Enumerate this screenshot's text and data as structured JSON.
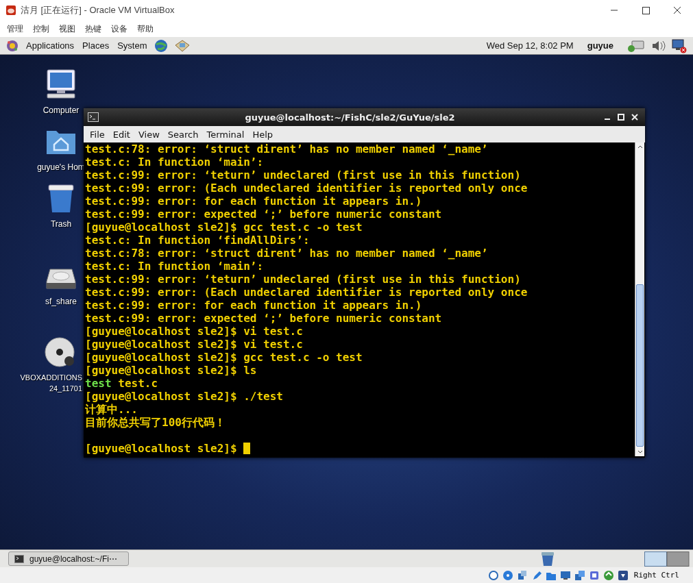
{
  "window": {
    "title": "沽月 [正在运行] - Oracle VM VirtualBox"
  },
  "menu": [
    "管理",
    "控制",
    "视图",
    "热键",
    "设备",
    "帮助"
  ],
  "top_panel": {
    "menus": [
      "Applications",
      "Places",
      "System"
    ],
    "clock": "Wed Sep 12,  8:02 PM",
    "user": "guyue"
  },
  "desktop_icons": [
    {
      "kind": "computer",
      "label": "Computer"
    },
    {
      "kind": "home",
      "label": "guyue's Hom"
    },
    {
      "kind": "trash",
      "label": "Trash"
    },
    {
      "kind": "drive",
      "label": "sf_share"
    },
    {
      "kind": "disc",
      "label": "VBOXADDITIONS\n24_11701"
    }
  ],
  "terminal": {
    "title": "guyue@localhost:~/FishC/sle2/GuYue/sle2",
    "menu": [
      "File",
      "Edit",
      "View",
      "Search",
      "Terminal",
      "Help"
    ],
    "lines": [
      {
        "kind": "text",
        "text": "test.c:78: error: ‘struct dirent’ has no member named ‘_name’"
      },
      {
        "kind": "text",
        "text": "test.c: In function ‘main’:"
      },
      {
        "kind": "text",
        "text": "test.c:99: error: ‘teturn’ undeclared (first use in this function)"
      },
      {
        "kind": "text",
        "text": "test.c:99: error: (Each undeclared identifier is reported only once"
      },
      {
        "kind": "text",
        "text": "test.c:99: error: for each function it appears in.)"
      },
      {
        "kind": "text",
        "text": "test.c:99: error: expected ‘;’ before numeric constant"
      },
      {
        "kind": "text",
        "text": "[guyue@localhost sle2]$ gcc test.c -o test"
      },
      {
        "kind": "text",
        "text": "test.c: In function ‘findAllDirs’:"
      },
      {
        "kind": "text",
        "text": "test.c:78: error: ‘struct dirent’ has no member named ‘_name’"
      },
      {
        "kind": "text",
        "text": "test.c: In function ‘main’:"
      },
      {
        "kind": "text",
        "text": "test.c:99: error: ‘teturn’ undeclared (first use in this function)"
      },
      {
        "kind": "text",
        "text": "test.c:99: error: (Each undeclared identifier is reported only once"
      },
      {
        "kind": "text",
        "text": "test.c:99: error: for each function it appears in.)"
      },
      {
        "kind": "text",
        "text": "test.c:99: error: expected ‘;’ before numeric constant"
      },
      {
        "kind": "text",
        "text": "[guyue@localhost sle2]$ vi test.c"
      },
      {
        "kind": "text",
        "text": "[guyue@localhost sle2]$ vi test.c"
      },
      {
        "kind": "text",
        "text": "[guyue@localhost sle2]$ gcc test.c -o test"
      },
      {
        "kind": "text",
        "text": "[guyue@localhost sle2]$ ls"
      },
      {
        "kind": "listing",
        "entries": [
          {
            "name": "test",
            "executable": true
          },
          {
            "name": "test.c",
            "executable": false
          }
        ]
      },
      {
        "kind": "text",
        "text": "[guyue@localhost sle2]$ ./test"
      },
      {
        "kind": "text",
        "text": "计算中..."
      },
      {
        "kind": "text",
        "text": "目前你总共写了100行代码！"
      },
      {
        "kind": "blank"
      },
      {
        "kind": "prompt",
        "text": "[guyue@localhost sle2]$ ",
        "cursor": true
      }
    ]
  },
  "taskbar": [
    {
      "label": "guyue@localhost:~/Fi⋯",
      "selected": false
    }
  ],
  "status_bar": {
    "host_key": "Right Ctrl"
  }
}
